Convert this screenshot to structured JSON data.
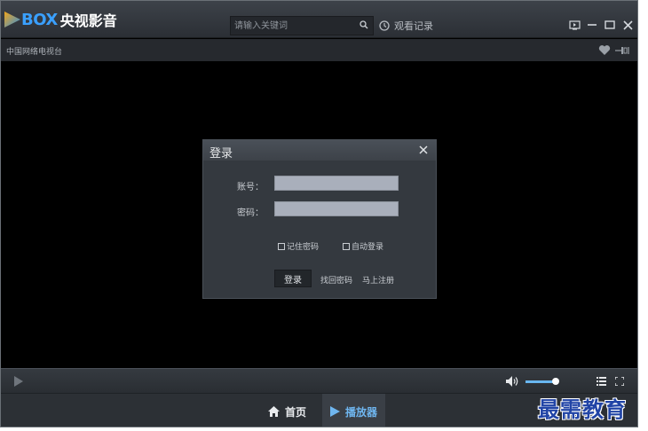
{
  "app": {
    "logo_box": "BOX",
    "logo_name": "央视影音",
    "search_placeholder": "请输入关键词",
    "history_label": "观看记录",
    "channel_name": "中国网络电视台"
  },
  "login_dialog": {
    "title": "登录",
    "account_label": "账号：",
    "account_value": "",
    "password_label": "密码：",
    "password_value": "",
    "remember_password": "记住密码",
    "remember_checked": false,
    "auto_login": "自动登录",
    "auto_login_checked": false,
    "login_button": "登录",
    "forgot_password": "找回密码",
    "register": "马上注册"
  },
  "controls": {
    "volume": 0.9
  },
  "nav": {
    "home": "首页",
    "player": "播放器",
    "active": "player"
  },
  "watermark": "最需教育",
  "colors": {
    "accent": "#6fb6f0",
    "logo_blue": "#3aa0ff",
    "watermark": "#2144a6"
  },
  "icons": [
    "search-icon",
    "clock-icon",
    "tv-icon",
    "minimize-icon",
    "maximize-icon",
    "close-icon",
    "heart-icon",
    "pin-icon",
    "play-icon",
    "volume-icon",
    "list-icon",
    "fullscreen-icon",
    "home-icon",
    "player-icon"
  ]
}
